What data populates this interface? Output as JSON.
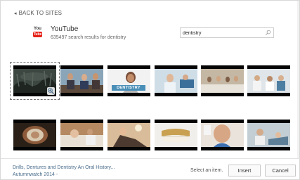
{
  "nav": {
    "back_label": "BACK TO SITES"
  },
  "provider": {
    "logo_you": "You",
    "logo_tube": "Tube",
    "name": "YouTube",
    "result_count": "635497 search results for dentistry",
    "brand_color": "#e62117"
  },
  "search": {
    "value": "dentistry",
    "icon": "magnifier-icon"
  },
  "thumbnails": [
    {
      "caption": "",
      "palette": "dark-forest",
      "selected": true
    },
    {
      "caption": "",
      "palette": "office-people"
    },
    {
      "caption": "DENTISTRY",
      "palette": "presenter"
    },
    {
      "caption": "",
      "palette": "clinic-blue"
    },
    {
      "caption": "",
      "palette": "classroom"
    },
    {
      "caption": "",
      "palette": "dental-team"
    },
    {
      "caption": "",
      "palette": "close-up-mouth"
    },
    {
      "caption": "",
      "palette": "patient-chair"
    },
    {
      "caption": "",
      "palette": "patient-lamp"
    },
    {
      "caption": "",
      "palette": "dentures"
    },
    {
      "caption": "",
      "palette": "man-closeup"
    },
    {
      "caption": "",
      "palette": "treatment"
    }
  ],
  "footer": {
    "title": "Drills, Dentures and Dentistry An Oral History...",
    "subtitle": "Autumnwatch 2014 -",
    "status": "Select an item.",
    "insert_label": "Insert",
    "cancel_label": "Cancel"
  }
}
